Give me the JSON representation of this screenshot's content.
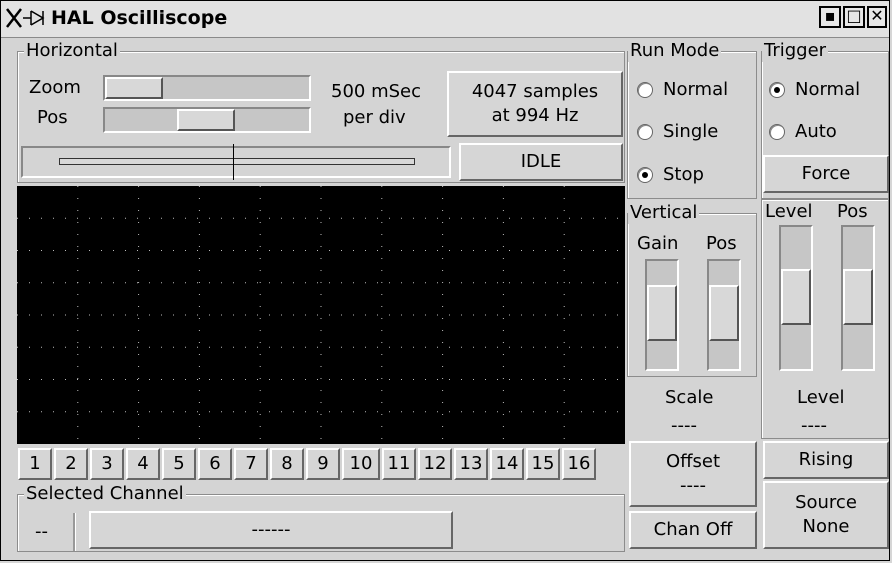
{
  "window": {
    "title": "HAL Oscilliscope"
  },
  "horizontal": {
    "legend": "Horizontal",
    "zoom_label": "Zoom",
    "pos_label": "Pos",
    "rate_line1": "500 mSec",
    "rate_line2": "per div",
    "samples_line1": "4047 samples",
    "samples_line2": "at 994 Hz",
    "status": "IDLE"
  },
  "run_mode": {
    "legend": "Run Mode",
    "options": [
      {
        "label": "Normal",
        "selected": false
      },
      {
        "label": "Single",
        "selected": false
      },
      {
        "label": "Stop",
        "selected": true
      }
    ]
  },
  "trigger": {
    "legend": "Trigger",
    "options": [
      {
        "label": "Normal",
        "selected": true
      },
      {
        "label": "Auto",
        "selected": false
      }
    ],
    "force_label": "Force",
    "level_header": "Level",
    "pos_header": "Pos",
    "level_label": "Level",
    "level_value": "----",
    "edge_button": "Rising",
    "source_line1": "Source",
    "source_line2": "None"
  },
  "vertical": {
    "legend": "Vertical",
    "gain_header": "Gain",
    "pos_header": "Pos",
    "scale_label": "Scale",
    "scale_value": "----",
    "offset_line1": "Offset",
    "offset_line2": "----",
    "chan_off_label": "Chan Off"
  },
  "channels": [
    "1",
    "2",
    "3",
    "4",
    "5",
    "6",
    "7",
    "8",
    "9",
    "10",
    "11",
    "12",
    "13",
    "14",
    "15",
    "16"
  ],
  "selected_channel": {
    "legend": "Selected Channel",
    "number": "--",
    "name": "------"
  },
  "icons": {
    "title": "hal-logo-icon",
    "min": "minimize-icon",
    "max": "maximize-icon",
    "close": "close-icon"
  }
}
